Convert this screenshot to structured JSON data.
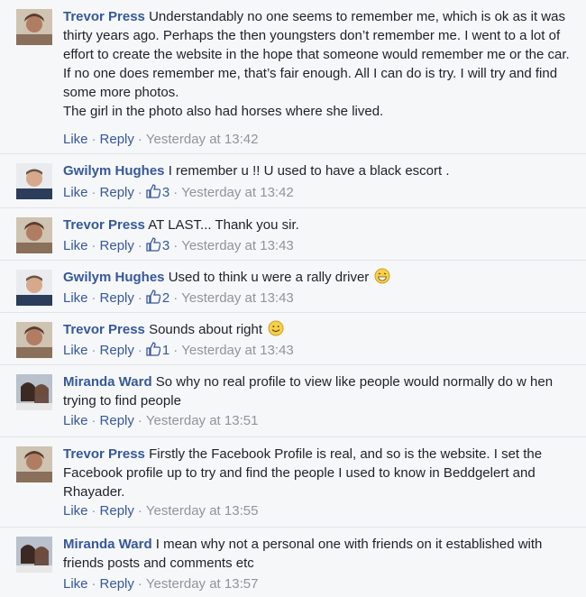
{
  "comments": [
    {
      "author": "Trevor Press",
      "text": "Understandably no one seems to remember me, which is ok as it was thirty years ago. Perhaps the then youngsters don’t remember me. I went to a lot of effort to create the website in the hope that someone would remember me or the car. If no one does remember me, that’s fair enough. All I can do is try. I will try and find some more photos.",
      "text2": "The girl in the photo also had horses where she lived.",
      "like": "Like",
      "reply": "Reply",
      "likes": "",
      "time": "Yesterday at 13:42"
    },
    {
      "author": "Gwilym Hughes",
      "text": "I remember u !! U used to have a black escort .",
      "like": "Like",
      "reply": "Reply",
      "likes": "3",
      "time": "Yesterday at 13:42"
    },
    {
      "author": "Trevor Press",
      "text": "AT LAST... Thank you sir.",
      "like": "Like",
      "reply": "Reply",
      "likes": "3",
      "time": "Yesterday at 13:43"
    },
    {
      "author": "Gwilym Hughes",
      "text": "Used to think u were a rally driver",
      "emoji": "grin-emoji",
      "like": "Like",
      "reply": "Reply",
      "likes": "2",
      "time": "Yesterday at 13:43"
    },
    {
      "author": "Trevor Press",
      "text": "Sounds about right",
      "emoji": "smile-emoji",
      "like": "Like",
      "reply": "Reply",
      "likes": "1",
      "time": "Yesterday at 13:43"
    },
    {
      "author": "Miranda Ward",
      "text": "So why no real profile to view like people would normally do w hen trying to find people",
      "like": "Like",
      "reply": "Reply",
      "likes": "",
      "time": "Yesterday at 13:51"
    },
    {
      "author": "Trevor Press",
      "text": "Firstly the Facebook Profile is real, and so is the website. I set the Facebook profile up to try and find the people I used to know in Beddgelert and Rhayader.",
      "like": "Like",
      "reply": "Reply",
      "likes": "",
      "time": "Yesterday at 13:55"
    },
    {
      "author": "Miranda Ward",
      "text": "I mean why not a personal one with friends on it established with friends posts and comments etc",
      "like": "Like",
      "reply": "Reply",
      "likes": "",
      "time": "Yesterday at 13:57"
    }
  ],
  "colors": {
    "link": "#365899",
    "meta": "#90949c",
    "background": "#f6f7f9"
  }
}
